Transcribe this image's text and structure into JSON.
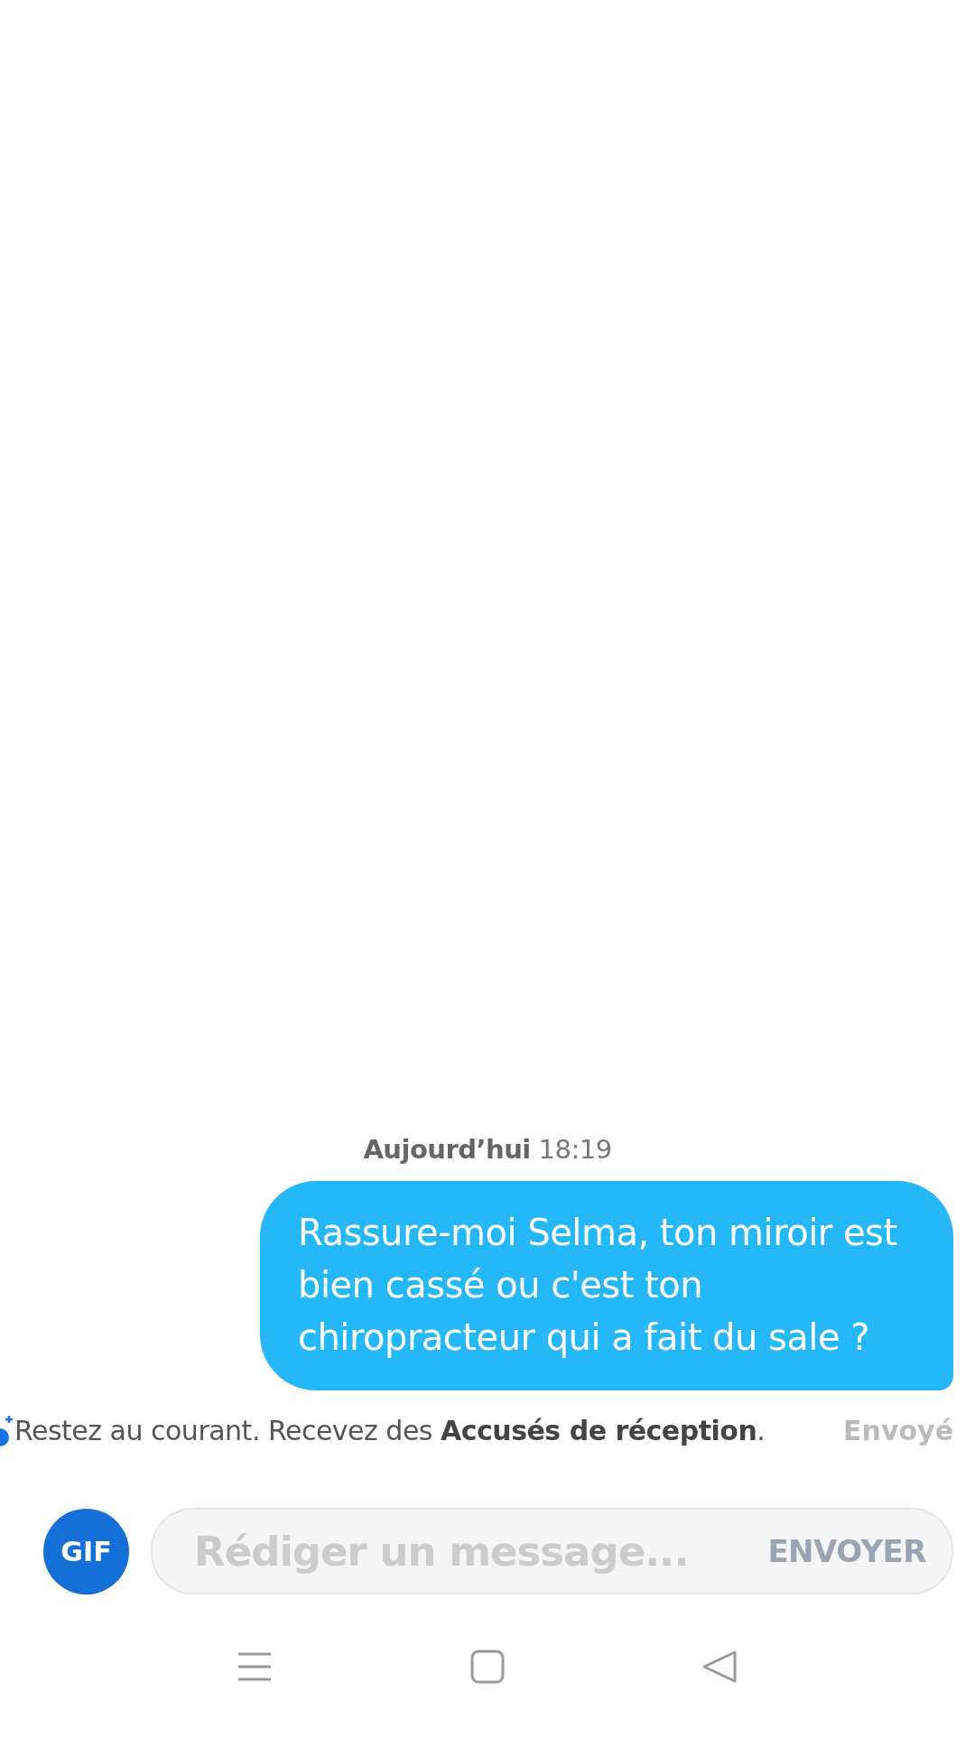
{
  "timestamp": {
    "day": "Aujourd’hui",
    "time": "18:19"
  },
  "message": {
    "text": "Rassure-moi Selma, ton miroir est bien cassé ou c'est ton chiropracteur qui a fait du sale ?"
  },
  "receipt_promo": "Restez au courant. Recevez des **Accusés de réception**.",
  "status": "Envoyé",
  "composer": {
    "gif_label": "GIF",
    "placeholder": "Rédiger un message...",
    "send_label": "ENVOYER"
  }
}
